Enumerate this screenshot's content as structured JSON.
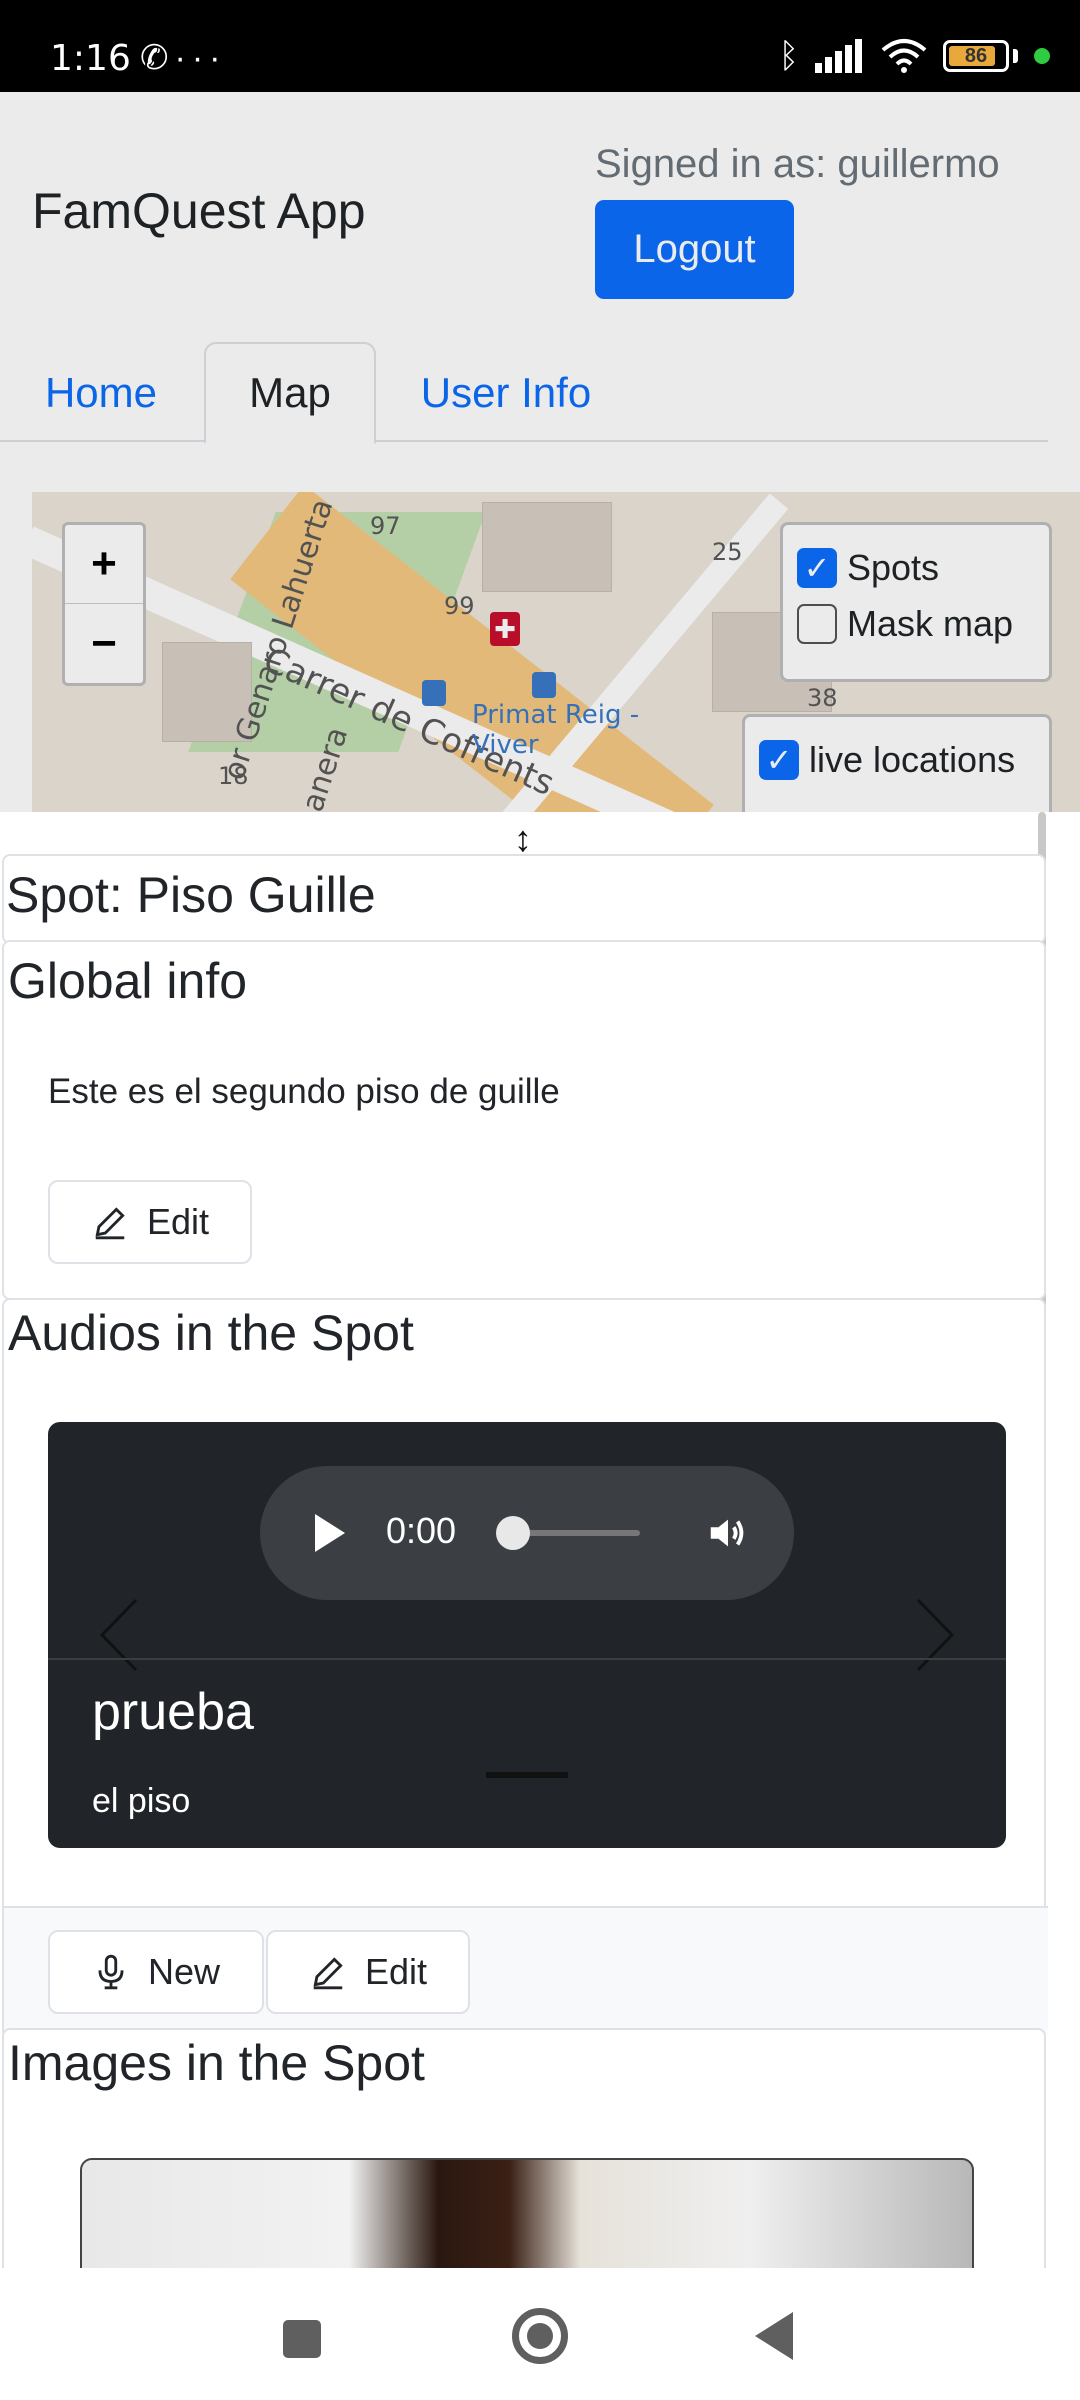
{
  "status_bar": {
    "time": "1:16",
    "left_icons": [
      "whatsapp-icon",
      "more-icon"
    ],
    "right_icons": [
      "bluetooth-icon",
      "signal-icon",
      "wifi-icon",
      "battery-icon"
    ],
    "battery_level": "86",
    "battery_color": "#e8a93a"
  },
  "header": {
    "brand": "FamQuest App",
    "signed_in": "Signed in as: guillermo",
    "logout_label": "Logout",
    "accent": "#0d6efd"
  },
  "tabs": [
    {
      "label": "Home",
      "active": false
    },
    {
      "label": "Map",
      "active": true
    },
    {
      "label": "User Info",
      "active": false
    }
  ],
  "map": {
    "zoom_in": "+",
    "zoom_out": "−",
    "labels": {
      "street1": "Carrer de Cofrents",
      "street2": "or Genaro Lahuerta",
      "street3": "anera",
      "stop": "Primat Reig - Viver",
      "num97": "97",
      "num99": "99",
      "num25": "25",
      "num18": "18",
      "num38": "38"
    },
    "controls": {
      "spots": {
        "label": "Spots",
        "checked": true
      },
      "mask_map": {
        "label": "Mask map",
        "checked": false
      },
      "live_locations": {
        "label": "live locations",
        "checked": true
      }
    }
  },
  "spot": {
    "title": "Spot: Piso Guille",
    "global_info": {
      "title": "Global info",
      "text": "Este es el segundo piso de guille",
      "edit_label": "Edit"
    },
    "audios": {
      "title": "Audios in the Spot",
      "time": "0:00",
      "progress": 0,
      "caption_title": "prueba",
      "caption_sub": "el piso",
      "new_label": "New",
      "edit_label": "Edit"
    },
    "images": {
      "title": "Images in the Spot"
    }
  }
}
